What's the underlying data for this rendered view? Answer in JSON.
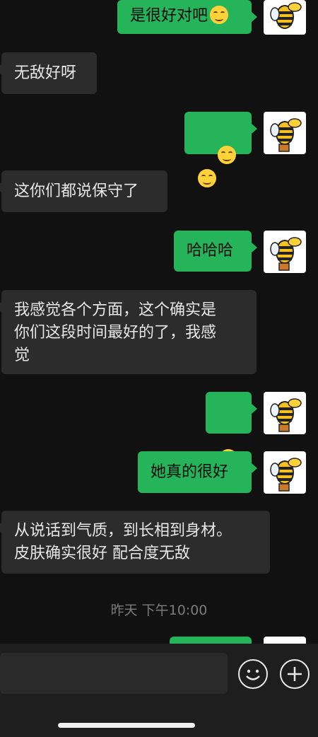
{
  "messages": [
    {
      "id": "m1",
      "dir": "out",
      "text": "是很好对吧",
      "emojis": 1
    },
    {
      "id": "m2",
      "dir": "in",
      "text": "无敌好呀",
      "emojis": 0
    },
    {
      "id": "m3",
      "dir": "out",
      "text": "",
      "emojis": 2
    },
    {
      "id": "m4",
      "dir": "in",
      "text": "这你们都说保守了",
      "emojis": 0
    },
    {
      "id": "m5",
      "dir": "out",
      "text": "哈哈哈",
      "emojis": 0
    },
    {
      "id": "m6",
      "dir": "in",
      "text": "我感觉各个方面，这个确实是\n你们这段时间最好的了，我感\n觉",
      "emojis": 0
    },
    {
      "id": "m7",
      "dir": "out",
      "text": "",
      "emojis": 1
    },
    {
      "id": "m8",
      "dir": "out",
      "text": "她真的很好",
      "emojis": 0
    },
    {
      "id": "m9",
      "dir": "in",
      "text": "从说话到气质，到长相到身材。\n皮肤确实很好 配合度无敌",
      "emojis": 0
    }
  ],
  "timestamp": "昨天 下午10:00",
  "colors": {
    "background": "#111111",
    "incoming": "#2c2c2c",
    "outgoing": "#26b45a"
  },
  "icons": {
    "avatar": "bee-avatar-icon",
    "emoji_button": "emoji-icon",
    "plus_button": "plus-icon",
    "smile": "smiling-face-icon"
  }
}
